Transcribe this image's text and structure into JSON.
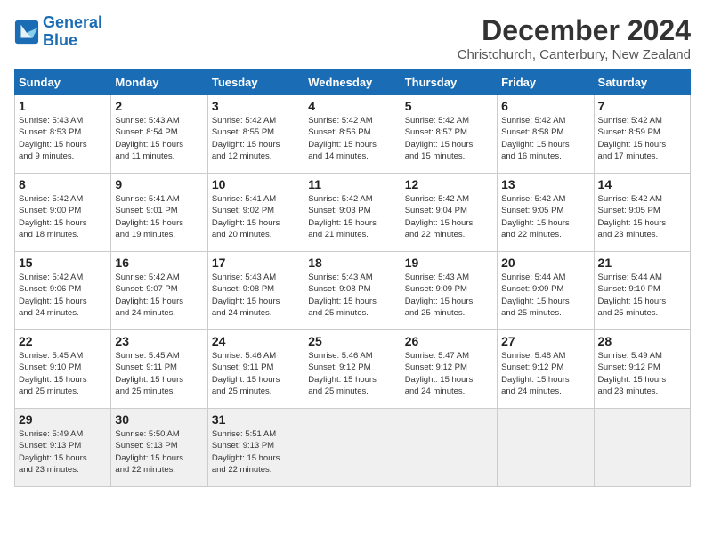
{
  "logo": {
    "line1": "General",
    "line2": "Blue"
  },
  "title": "December 2024",
  "subtitle": "Christchurch, Canterbury, New Zealand",
  "weekdays": [
    "Sunday",
    "Monday",
    "Tuesday",
    "Wednesday",
    "Thursday",
    "Friday",
    "Saturday"
  ],
  "weeks": [
    [
      {
        "day": "1",
        "sunrise": "5:43 AM",
        "sunset": "8:53 PM",
        "daylight": "15 hours and 9 minutes."
      },
      {
        "day": "2",
        "sunrise": "5:43 AM",
        "sunset": "8:54 PM",
        "daylight": "15 hours and 11 minutes."
      },
      {
        "day": "3",
        "sunrise": "5:42 AM",
        "sunset": "8:55 PM",
        "daylight": "15 hours and 12 minutes."
      },
      {
        "day": "4",
        "sunrise": "5:42 AM",
        "sunset": "8:56 PM",
        "daylight": "15 hours and 14 minutes."
      },
      {
        "day": "5",
        "sunrise": "5:42 AM",
        "sunset": "8:57 PM",
        "daylight": "15 hours and 15 minutes."
      },
      {
        "day": "6",
        "sunrise": "5:42 AM",
        "sunset": "8:58 PM",
        "daylight": "15 hours and 16 minutes."
      },
      {
        "day": "7",
        "sunrise": "5:42 AM",
        "sunset": "8:59 PM",
        "daylight": "15 hours and 17 minutes."
      }
    ],
    [
      {
        "day": "8",
        "sunrise": "5:42 AM",
        "sunset": "9:00 PM",
        "daylight": "15 hours and 18 minutes."
      },
      {
        "day": "9",
        "sunrise": "5:41 AM",
        "sunset": "9:01 PM",
        "daylight": "15 hours and 19 minutes."
      },
      {
        "day": "10",
        "sunrise": "5:41 AM",
        "sunset": "9:02 PM",
        "daylight": "15 hours and 20 minutes."
      },
      {
        "day": "11",
        "sunrise": "5:42 AM",
        "sunset": "9:03 PM",
        "daylight": "15 hours and 21 minutes."
      },
      {
        "day": "12",
        "sunrise": "5:42 AM",
        "sunset": "9:04 PM",
        "daylight": "15 hours and 22 minutes."
      },
      {
        "day": "13",
        "sunrise": "5:42 AM",
        "sunset": "9:05 PM",
        "daylight": "15 hours and 22 minutes."
      },
      {
        "day": "14",
        "sunrise": "5:42 AM",
        "sunset": "9:05 PM",
        "daylight": "15 hours and 23 minutes."
      }
    ],
    [
      {
        "day": "15",
        "sunrise": "5:42 AM",
        "sunset": "9:06 PM",
        "daylight": "15 hours and 24 minutes."
      },
      {
        "day": "16",
        "sunrise": "5:42 AM",
        "sunset": "9:07 PM",
        "daylight": "15 hours and 24 minutes."
      },
      {
        "day": "17",
        "sunrise": "5:43 AM",
        "sunset": "9:08 PM",
        "daylight": "15 hours and 24 minutes."
      },
      {
        "day": "18",
        "sunrise": "5:43 AM",
        "sunset": "9:08 PM",
        "daylight": "15 hours and 25 minutes."
      },
      {
        "day": "19",
        "sunrise": "5:43 AM",
        "sunset": "9:09 PM",
        "daylight": "15 hours and 25 minutes."
      },
      {
        "day": "20",
        "sunrise": "5:44 AM",
        "sunset": "9:09 PM",
        "daylight": "15 hours and 25 minutes."
      },
      {
        "day": "21",
        "sunrise": "5:44 AM",
        "sunset": "9:10 PM",
        "daylight": "15 hours and 25 minutes."
      }
    ],
    [
      {
        "day": "22",
        "sunrise": "5:45 AM",
        "sunset": "9:10 PM",
        "daylight": "15 hours and 25 minutes."
      },
      {
        "day": "23",
        "sunrise": "5:45 AM",
        "sunset": "9:11 PM",
        "daylight": "15 hours and 25 minutes."
      },
      {
        "day": "24",
        "sunrise": "5:46 AM",
        "sunset": "9:11 PM",
        "daylight": "15 hours and 25 minutes."
      },
      {
        "day": "25",
        "sunrise": "5:46 AM",
        "sunset": "9:12 PM",
        "daylight": "15 hours and 25 minutes."
      },
      {
        "day": "26",
        "sunrise": "5:47 AM",
        "sunset": "9:12 PM",
        "daylight": "15 hours and 24 minutes."
      },
      {
        "day": "27",
        "sunrise": "5:48 AM",
        "sunset": "9:12 PM",
        "daylight": "15 hours and 24 minutes."
      },
      {
        "day": "28",
        "sunrise": "5:49 AM",
        "sunset": "9:12 PM",
        "daylight": "15 hours and 23 minutes."
      }
    ],
    [
      {
        "day": "29",
        "sunrise": "5:49 AM",
        "sunset": "9:13 PM",
        "daylight": "15 hours and 23 minutes."
      },
      {
        "day": "30",
        "sunrise": "5:50 AM",
        "sunset": "9:13 PM",
        "daylight": "15 hours and 22 minutes."
      },
      {
        "day": "31",
        "sunrise": "5:51 AM",
        "sunset": "9:13 PM",
        "daylight": "15 hours and 22 minutes."
      },
      null,
      null,
      null,
      null
    ]
  ],
  "labels": {
    "sunrise": "Sunrise:",
    "sunset": "Sunset:",
    "daylight": "Daylight: 15 hours"
  }
}
